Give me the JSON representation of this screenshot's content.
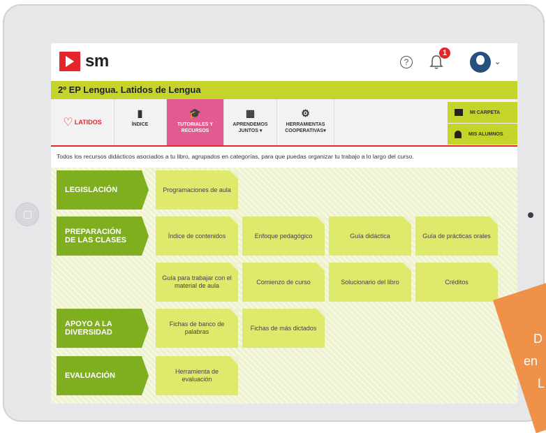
{
  "app": {
    "logo_text": "sm",
    "course_title": "2º EP Lengua. Latidos de Lengua",
    "notification_count": "1"
  },
  "nav": {
    "logo_label": "LATIDOS",
    "tabs": [
      {
        "label": "ÍNDICE",
        "icon": "book-icon"
      },
      {
        "label": "TUTORIALES Y RECURSOS",
        "icon": "graduation-cap-icon",
        "active": true
      },
      {
        "label": "APRENDEMOS JUNTOS ▾",
        "icon": "puzzle-icon"
      },
      {
        "label": "HERRAMIENTAS COOPERATIVAS▾",
        "icon": "gears-icon"
      }
    ],
    "side_buttons": [
      {
        "label": "MI CARPETA",
        "icon": "folder-icon"
      },
      {
        "label": "MIS ALUMNOS",
        "icon": "user-icon"
      }
    ]
  },
  "description": "Todos los recursos didácticos asociados a tu libro, agrupados en categorías, para que puedas organizar tu trabajo a lo largo del curso.",
  "categories": [
    {
      "label": "LEGISLACIÓN",
      "items": [
        "Programaciones de aula"
      ]
    },
    {
      "label": "PREPARACIÓN DE LAS CLASES",
      "items": [
        "Índice de contenidos",
        "Enfoque pedagógico",
        "Guía didáctica",
        "Guía de prácticas orales",
        "Guía para trabajar con el material de aula",
        "Comienzo de curso",
        "Solucionario del libro",
        "Créditos"
      ]
    },
    {
      "label": "APOYO A LA DIVERSIDAD",
      "items": [
        "Fichas de banco de palabras",
        "Fichas de más dictados"
      ]
    },
    {
      "label": "EVALUACIÓN",
      "items": [
        "Herramienta de evaluación"
      ]
    }
  ],
  "promo": {
    "lines": [
      "D",
      "en",
      "L"
    ]
  },
  "colors": {
    "accent_green": "#c5d42a",
    "category_green": "#7faf1e",
    "card_yellow": "#dfe96b",
    "active_tab": "#e35a91",
    "brand_red": "#e3262c",
    "promo_orange": "#f0914a"
  }
}
